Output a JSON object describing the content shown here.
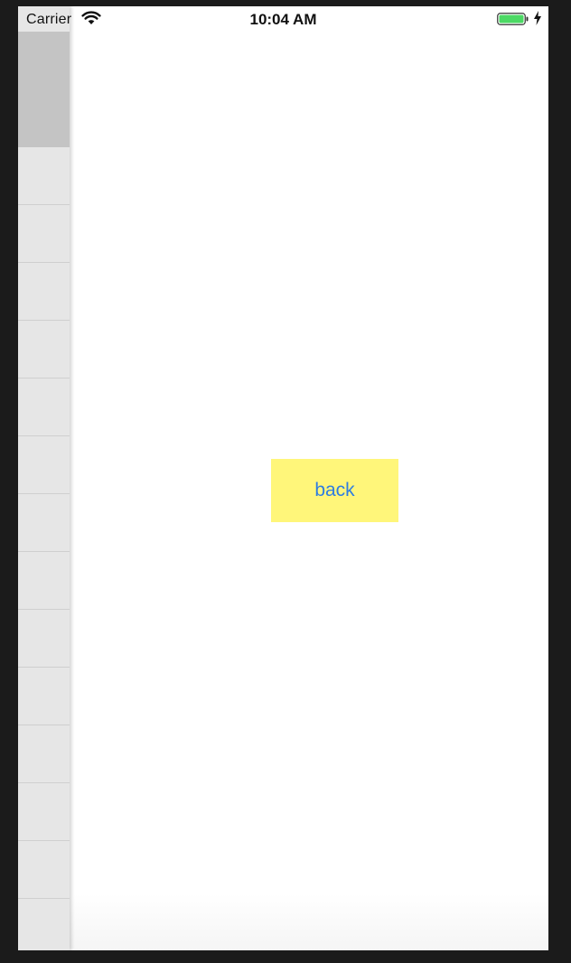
{
  "status_bar": {
    "carrier": "Carrier",
    "time": "10:04 AM",
    "battery_color": "#4cd964",
    "icons": [
      "wifi-icon",
      "battery-icon",
      "charging-bolt-icon"
    ]
  },
  "side_panel": {
    "background": "#e6e6e6",
    "selected_background": "#c4c4c4",
    "row_count": 14
  },
  "main": {
    "back_button_label": "back",
    "back_button_background": "#fff67a",
    "back_button_text_color": "#2f7de1"
  }
}
